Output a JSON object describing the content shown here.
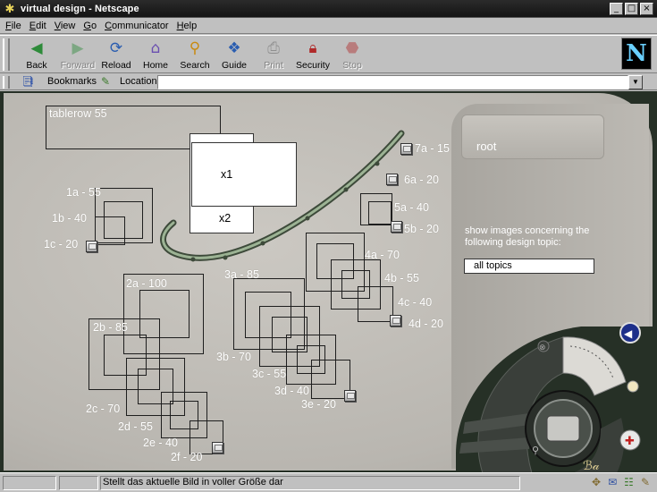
{
  "window": {
    "title": "virtual design - Netscape",
    "buttons": [
      "_",
      "□",
      "×"
    ]
  },
  "menu": [
    "File",
    "Edit",
    "View",
    "Go",
    "Communicator",
    "Help"
  ],
  "toolbar": {
    "back": "Back",
    "forward": "Forward",
    "reload": "Reload",
    "home": "Home",
    "search": "Search",
    "guide": "Guide",
    "print": "Print",
    "security": "Security",
    "stop": "Stop"
  },
  "location": {
    "bookmarks": "Bookmarks",
    "label": "Location:",
    "value": ""
  },
  "canvas": {
    "tablerow": "tablerow  55",
    "x1": "x1",
    "x2": "x2",
    "labels": {
      "a1": "1a - 55",
      "b1": "1b - 40",
      "c1": "1c - 20",
      "a2": "2a - 100",
      "b2": "2b - 85",
      "c2": "2c - 70",
      "d2": "2d - 55",
      "e2": "2e - 40",
      "f2": "2f - 20",
      "a3": "3a - 85",
      "b3": "3b - 70",
      "c3": "3c - 55",
      "d3": "3d - 40",
      "e3": "3e - 20",
      "a4": "4a - 70",
      "b4": "4b - 55",
      "c4": "4c - 40",
      "d4": "4d - 20",
      "a5": "5a - 40",
      "b5": "5b - 20",
      "a6": "6a - 20",
      "a7": "7a - 15"
    }
  },
  "panel": {
    "root": "root",
    "topic_prompt": "show images concerning the following design topic:",
    "topic_value": "all topics"
  },
  "status": {
    "text": "Stellt das aktuelle Bild in voller Größe dar"
  },
  "colors": {
    "title_bar": "#1c1c1c",
    "chrome": "#c0c0c0",
    "canvas": "#c2bfb9",
    "dark_frame": "#263026",
    "accent_green": "#7fa07a"
  }
}
